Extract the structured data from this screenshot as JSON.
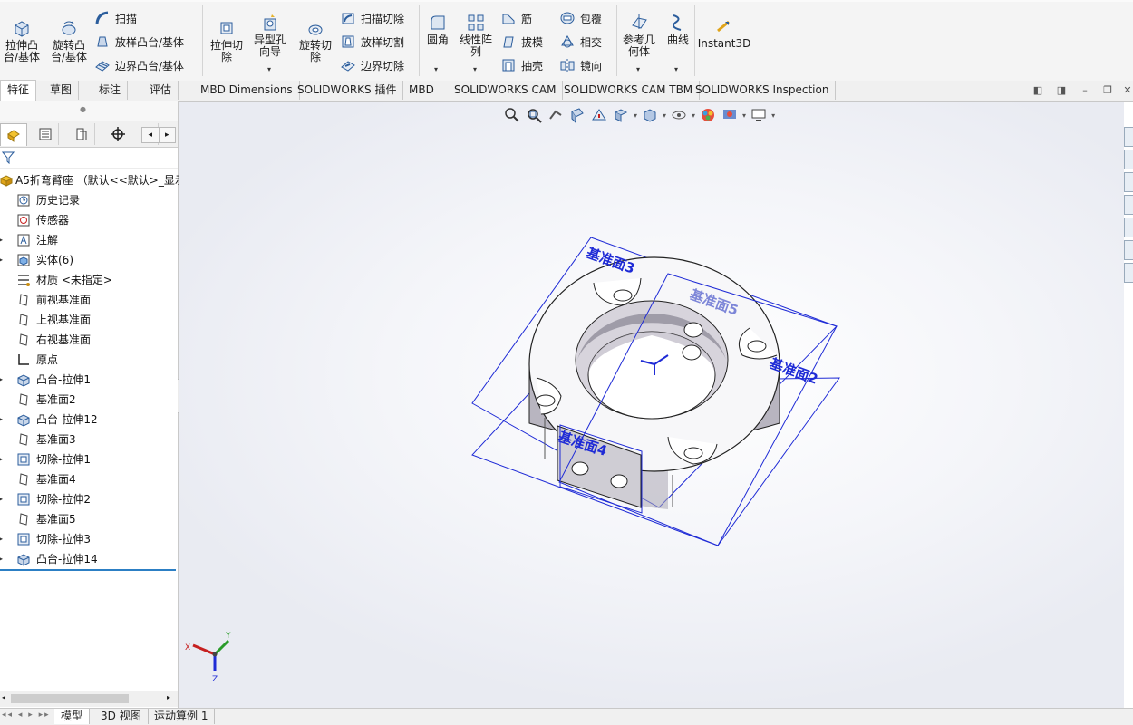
{
  "ribbon": {
    "extrude_boss": "拉伸凸\n台/基体",
    "revolve_boss": "旋转凸\n台/基体",
    "sweep": "扫描",
    "loft_boss": "放样凸台/基体",
    "boundary_boss": "边界凸台/基体",
    "extrude_cut": "拉伸切\n除",
    "hole_wizard": "异型孔\n向导",
    "revolve_cut": "旋转切\n除",
    "sweep_cut": "扫描切除",
    "loft_cut": "放样切割",
    "boundary_cut": "边界切除",
    "fillet": "圆角",
    "linear_pattern": "线性阵\n列",
    "rib": "筋",
    "wrap": "包覆",
    "draft": "拔模",
    "intersect": "相交",
    "shell": "抽壳",
    "mirror": "镜向",
    "ref_geometry": "参考几\n何体",
    "curves": "曲线",
    "instant3d": "Instant3D"
  },
  "tabs": [
    "特征",
    "草图",
    "标注",
    "评估",
    "MBD Dimensions",
    "SOLIDWORKS 插件",
    "MBD",
    "SOLIDWORKS CAM",
    "SOLIDWORKS CAM TBM",
    "SOLIDWORKS Inspection"
  ],
  "tree": {
    "root": "A5折弯臂座 （默认<<默认>_显示",
    "items": [
      {
        "label": "历史记录",
        "icon": "history-icon",
        "expandable": false
      },
      {
        "label": "传感器",
        "icon": "sensor-icon",
        "expandable": false
      },
      {
        "label": "注解",
        "icon": "annotation-icon",
        "expandable": true
      },
      {
        "label": "实体(6)",
        "icon": "solid-bodies-icon",
        "expandable": true
      },
      {
        "label": "材质 <未指定>",
        "icon": "material-icon",
        "expandable": false
      },
      {
        "label": "前视基准面",
        "icon": "plane-icon",
        "expandable": false
      },
      {
        "label": "上视基准面",
        "icon": "plane-icon",
        "expandable": false
      },
      {
        "label": "右视基准面",
        "icon": "plane-icon",
        "expandable": false
      },
      {
        "label": "原点",
        "icon": "origin-icon",
        "expandable": false
      },
      {
        "label": "凸台-拉伸1",
        "icon": "boss-extrude-icon",
        "expandable": true
      },
      {
        "label": "基准面2",
        "icon": "plane-icon",
        "expandable": false
      },
      {
        "label": "凸台-拉伸12",
        "icon": "boss-extrude-icon",
        "expandable": true
      },
      {
        "label": "基准面3",
        "icon": "plane-icon",
        "expandable": false
      },
      {
        "label": "切除-拉伸1",
        "icon": "cut-extrude-icon",
        "expandable": true
      },
      {
        "label": "基准面4",
        "icon": "plane-icon",
        "expandable": false
      },
      {
        "label": "切除-拉伸2",
        "icon": "cut-extrude-icon",
        "expandable": true
      },
      {
        "label": "基准面5",
        "icon": "plane-icon",
        "expandable": false
      },
      {
        "label": "切除-拉伸3",
        "icon": "cut-extrude-icon",
        "expandable": true
      },
      {
        "label": "凸台-拉伸14",
        "icon": "boss-extrude-icon",
        "expandable": true
      }
    ]
  },
  "viewport": {
    "plane_labels": [
      "基准面3",
      "基准面5",
      "基准面2",
      "基准面4"
    ],
    "triad": {
      "x": "X",
      "y": "Y",
      "z": "Z"
    },
    "plane_color": "#1f2bd6",
    "part_color": "#bfbcc6"
  },
  "bottom_tabs": [
    "模型",
    "3D 视图",
    "运动算例 1"
  ],
  "colors": {
    "accent": "#2c7fc4"
  }
}
